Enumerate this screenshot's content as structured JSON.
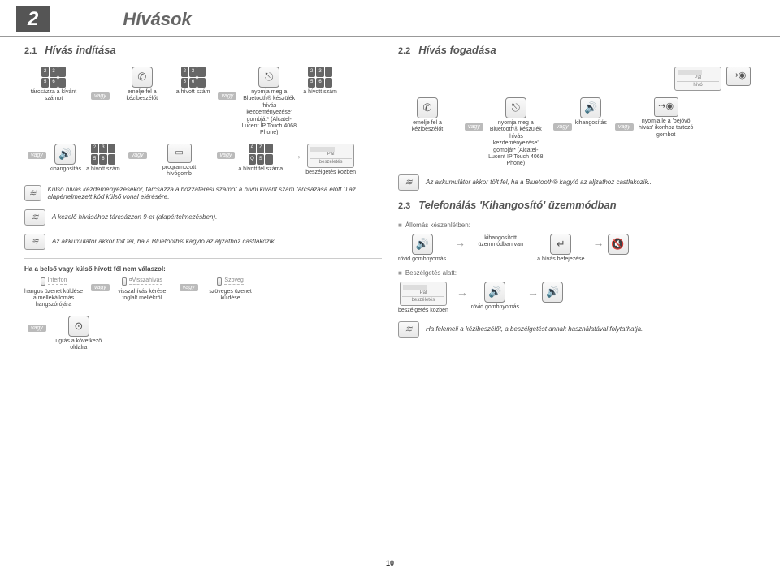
{
  "chapter": {
    "num": "2",
    "title": "Hívások"
  },
  "left": {
    "sec_num": "2.1",
    "sec_title": "Hívás indítása",
    "steps": {
      "dial": "tárcsázza a kívánt számot",
      "pickup": "emelje fel a kézibeszélőt",
      "number1": "a hívott szám",
      "bluetooth": "nyomja meg a Bluetooth® készülék 'hívás kezdeményezése' gombját* (Alcatel-Lucent IP Touch 4068 Phone)",
      "number2": "a hívott szám",
      "speaker": "kihangosítás",
      "number3": "a hívott szám",
      "progkey": "programozott hívógomb",
      "party": "a hívott fél száma",
      "inconv": "beszélgetés közben",
      "display_caller": "Pál",
      "display_sub": "beszéletés"
    },
    "note1": "Külső hívás kezdeményezésekor, tárcsázza a hozzáférési számot a hívni kívánt szám tárcsázása előtt 0 az alapértelmezett kód külső vonal elérésére.",
    "note2": "A kezelő hívásához tárcsázzon 9-et (alapértelmezésben).",
    "note3": "Az akkumulátor akkor tölt fel, ha a Bluetooth® kagyló az aljzathoz castlakozik..",
    "noanswer_head": "Ha a belső vagy külső hívott fél nem válaszol:",
    "soft": {
      "interfon": "Interfon",
      "recall": "¤Visszahívás",
      "text": "Szoveg"
    },
    "noanswer": {
      "broadcast": "hangos üzenet küldése a mellékállomás hangszórójára",
      "callback": "visszahívás kérése foglalt mellékről",
      "textmsg": "szöveges üzenet küldése"
    },
    "nextpage": "ugrás a következő oldalra"
  },
  "right": {
    "sec_num": "2.2",
    "sec_title": "Hívás fogadása",
    "display_top": {
      "caller": "Pál",
      "sub": "hívó"
    },
    "steps": {
      "pickup": "emelje fel a kézibeszélőt",
      "bluetooth": "nyomja meg a Bluetooth® készülék 'hívás kezdeményezése' gombját* (Alcatel-Lucent IP Touch 4068 Phone)",
      "speaker": "kihangosítás",
      "iconkey": "nyomja le a 'bejövő hívás' ikonhoz tartozó gombot"
    },
    "note_bt": "Az akkumulátor akkor tölt fel, ha a Bluetooth® kagyló az aljzathoz castlakozik..",
    "sec3_num": "2.3",
    "sec3_title": "Telefonálás 'Kihangosító' üzemmódban",
    "idle_label": "Állomás készenlétben:",
    "handsfree": "kihangosított üzemmódban van",
    "shortpress": "rövid gombnyomás",
    "endcall": "a hívás befejezése",
    "during_label": "Beszélgetés alatt:",
    "display_conv": {
      "caller": "Pál",
      "sub": "beszéletés"
    },
    "inconv": "beszélgetés közben",
    "shortpress2": "rövid gombnyomás",
    "note_lift": "Ha felemeli a kézibeszélőt, a beszélgetést annak használatával folytathatja."
  },
  "vagy": "vagy",
  "page": "10"
}
